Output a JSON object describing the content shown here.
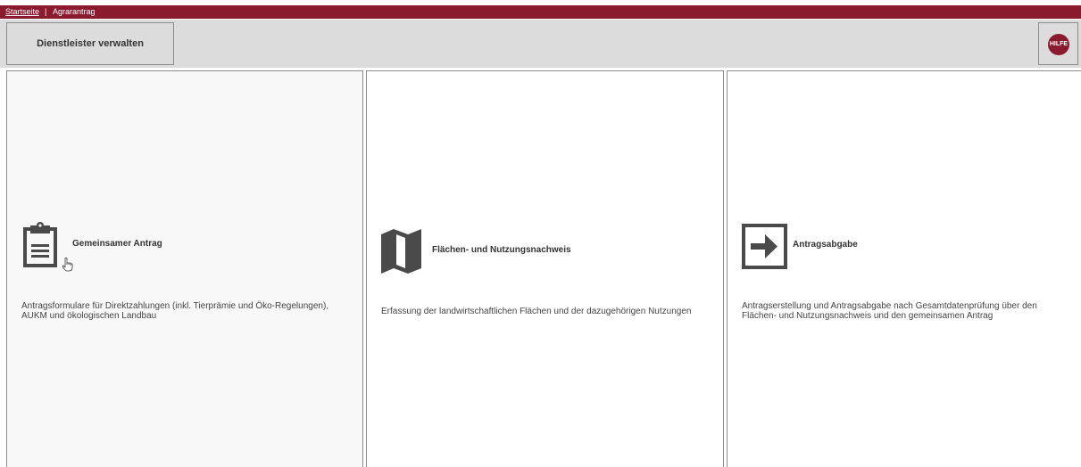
{
  "breadcrumb": {
    "home": "Startseite",
    "separator": "|",
    "current": "Agrarantrag"
  },
  "toolbar": {
    "manage_button": "Dienstleister verwalten",
    "help_button": "HILFE"
  },
  "tiles": [
    {
      "title": "Gemeinsamer Antrag",
      "desc_line1": "Antragsformulare für Direktzahlungen (inkl. Tierprämie und Öko-Regelungen),",
      "desc_line2": "AUKM und ökologischen Landbau",
      "icon": "clipboard-icon"
    },
    {
      "title": "Flächen- und Nutzungsnachweis",
      "desc_line1": "Erfassung der landwirtschaftlichen Flächen und der dazugehörigen Nutzungen",
      "icon": "map-icon"
    },
    {
      "title": "Antragsabgabe",
      "desc_line1": "Antragserstellung und Antragsabgabe nach Gesamtdatenprüfung über den",
      "desc_line2": "Flächen- und Nutzungsnachweis und den gemeinsamen Antrag",
      "icon": "submit-arrow-icon"
    }
  ],
  "colors": {
    "brand": "#8a1b2e",
    "toolbar_bg": "#dcdcdc",
    "icon": "#4a4a4a"
  }
}
